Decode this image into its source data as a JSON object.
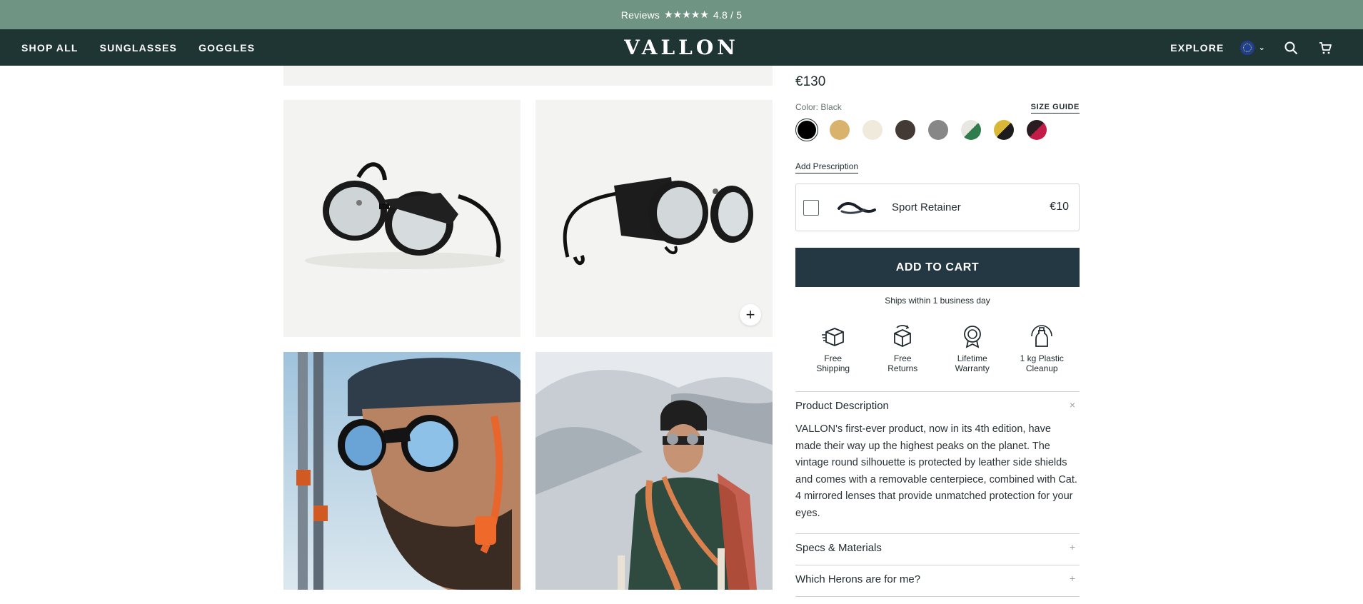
{
  "reviews_bar": {
    "label": "Reviews",
    "stars": "★★★★★",
    "rating": "4.8 / 5"
  },
  "nav": {
    "left_links": [
      "SHOP ALL",
      "SUNGLASSES",
      "GOGGLES"
    ],
    "brand": "VALLON",
    "explore_label": "EXPLORE",
    "icons": [
      "eu-flag-icon",
      "chevron-down-icon",
      "search-icon",
      "cart-icon"
    ]
  },
  "product": {
    "price": "€130",
    "color_label": "Color:",
    "color_value": "Black",
    "size_guide": "SIZE GUIDE",
    "swatches": [
      {
        "name": "black",
        "color": "#000000",
        "selected": true
      },
      {
        "name": "tan",
        "color": "#d9b36e"
      },
      {
        "name": "cream",
        "color": "#efeadb"
      },
      {
        "name": "dark-brown",
        "color": "#433935"
      },
      {
        "name": "grey",
        "color": "#878787"
      },
      {
        "name": "white-green",
        "color": "#2f7d4c",
        "color2": "#e8e8e3"
      },
      {
        "name": "black-yellow",
        "color": "#1c1c1c",
        "color2": "#d8b836"
      },
      {
        "name": "black-red",
        "color": "#2a1d22",
        "color2": "#c41c48"
      }
    ],
    "add_prescription": "Add Prescription",
    "addon": {
      "name": "Sport Retainer",
      "price": "€10",
      "checked": false
    },
    "add_to_cart": "ADD TO CART",
    "shipping_note": "Ships within 1 business day",
    "benefits": [
      {
        "icon": "shipping-box-icon",
        "label": "Free\nShipping"
      },
      {
        "icon": "returns-box-icon",
        "label": "Free\nReturns"
      },
      {
        "icon": "warranty-badge-icon",
        "label": "Lifetime\nWarranty"
      },
      {
        "icon": "plastic-cleanup-icon",
        "label": "1 kg Plastic\nCleanup"
      }
    ],
    "accordion": [
      {
        "title": "Product Description",
        "open": true,
        "toggle": "×",
        "body": "VALLON's first-ever product, now in its 4th edition, have made their way up the highest peaks on the planet. The vintage round silhouette is protected by leather side shields and comes with a removable centerpiece, combined with Cat. 4 mirrored lenses that provide unmatched protection for your eyes."
      },
      {
        "title": "Specs & Materials",
        "open": false,
        "toggle": "+"
      },
      {
        "title": "Which Herons are for me?",
        "open": false,
        "toggle": "+"
      }
    ]
  },
  "gallery": {
    "zoom": "+",
    "images": [
      "sunglasses-front-three-quarter",
      "sunglasses-side-view",
      "climber-closeup-wearing-sunglasses",
      "mountaineer-with-rope"
    ]
  }
}
